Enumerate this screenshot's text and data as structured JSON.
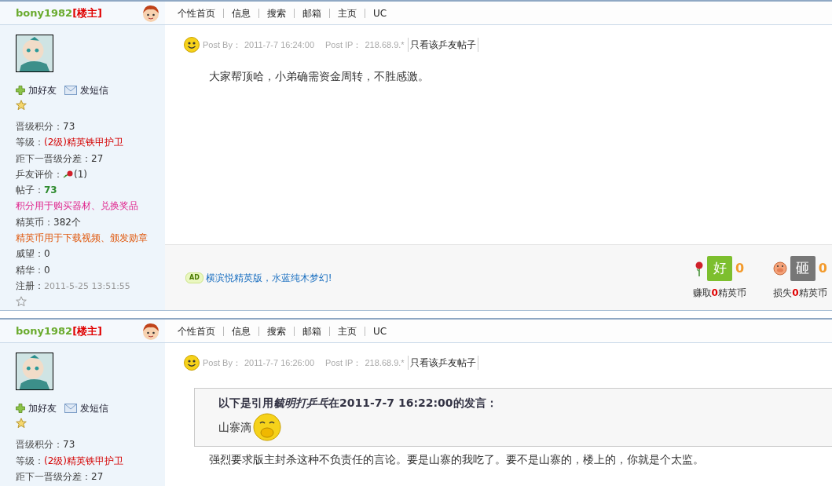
{
  "posts": [
    {
      "author": {
        "name": "bony1982",
        "tag": "[楼主]"
      },
      "nav": [
        "个性首页",
        "信息",
        "搜索",
        "邮箱",
        "主页",
        "UC"
      ],
      "actions": {
        "add_friend": "加好友",
        "message": "发短信"
      },
      "stats": [
        {
          "kind": "plain",
          "label": "晋级积分：",
          "value": "73"
        },
        {
          "kind": "rank",
          "label": "等级：",
          "value": "(2级)精英铁甲护卫"
        },
        {
          "kind": "plain",
          "label": "距下一晋级分差：",
          "value": "27"
        },
        {
          "kind": "rose",
          "label": "乒友评价：",
          "value": "(1)"
        },
        {
          "kind": "posts",
          "label": "帖子：",
          "value": "73"
        },
        {
          "kind": "note-points",
          "text": "积分用于购买器材、兑换奖品"
        },
        {
          "kind": "plain",
          "label": "精英币：",
          "value": "382个"
        },
        {
          "kind": "note-coins",
          "text": "精英币用于下载视频、颁发勋章"
        },
        {
          "kind": "plain",
          "label": "威望：",
          "value": "0"
        },
        {
          "kind": "plain",
          "label": "精华：",
          "value": "0"
        },
        {
          "kind": "date",
          "label": "注册：",
          "value": "2011-5-25 13:51:55"
        }
      ],
      "meta": {
        "by_label": "Post By：",
        "time": "2011-7-7 16:24:00",
        "ip_label": "Post IP：",
        "ip": "218.68.9.*",
        "only_link": "只看该乒友帖子"
      },
      "body": "大家帮顶哈，小弟确需资金周转，不胜感激。",
      "footer": {
        "ad_badge": "AD",
        "ad_text": "横滨悦精英版，水蓝纯木梦幻!",
        "good": {
          "label": "好",
          "count": "0",
          "caption": "赚取**0**精英币"
        },
        "bad": {
          "label": "砸",
          "count": "0",
          "caption": "损失**0**精英币"
        }
      }
    },
    {
      "author": {
        "name": "bony1982",
        "tag": "[楼主]"
      },
      "nav": [
        "个性首页",
        "信息",
        "搜索",
        "邮箱",
        "主页",
        "UC"
      ],
      "actions": {
        "add_friend": "加好友",
        "message": "发短信"
      },
      "stats": [
        {
          "kind": "plain",
          "label": "晋级积分：",
          "value": "73"
        },
        {
          "kind": "rank",
          "label": "等级：",
          "value": "(2级)精英铁甲护卫"
        },
        {
          "kind": "plain",
          "label": "距下一晋级分差：",
          "value": "27"
        }
      ],
      "meta": {
        "by_label": "Post By：",
        "time": "2011-7-7 16:26:00",
        "ip_label": "Post IP：",
        "ip": "218.68.9.*",
        "only_link": "只看该乒友帖子"
      },
      "quote": {
        "title_prefix": "以下是引用",
        "quoted_author": "毓明打乒乓",
        "title_suffix": "在2011-7-7 16:22:00的发言：",
        "text": "山寨滴"
      },
      "body": "强烈要求版主封杀这种不负责任的言论。要是山寨的我吃了。要不是山寨的，楼上的，你就是个太监。"
    }
  ]
}
